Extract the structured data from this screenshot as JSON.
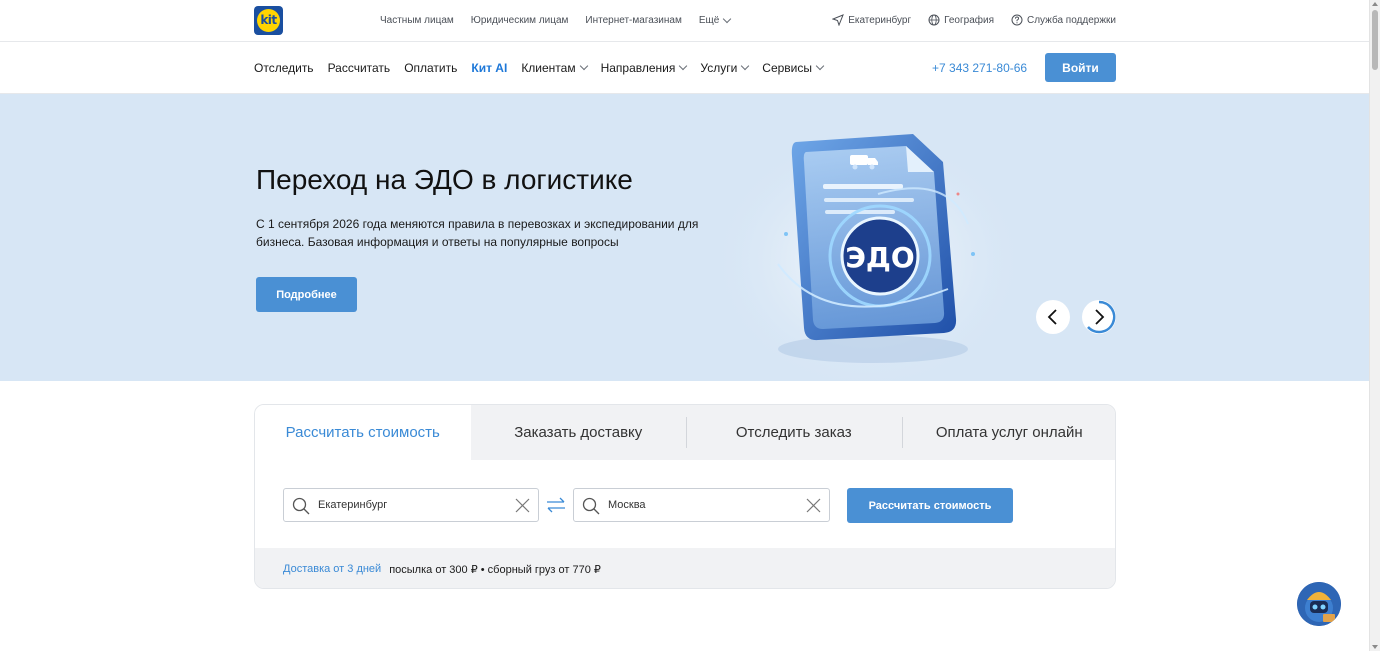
{
  "logo": {
    "text": "kit"
  },
  "topbar": {
    "links": [
      {
        "label": "Частным лицам"
      },
      {
        "label": "Юридическим лицам"
      },
      {
        "label": "Интернет-магазинам"
      },
      {
        "label": "Ещё"
      }
    ],
    "city": "Екатеринбург",
    "geography": "География",
    "support": "Служба поддержки"
  },
  "nav": {
    "items": [
      {
        "label": "Отследить"
      },
      {
        "label": "Рассчитать"
      },
      {
        "label": "Оплатить"
      },
      {
        "label": "Кит AI"
      },
      {
        "label": "Клиентам"
      },
      {
        "label": "Направления"
      },
      {
        "label": "Услуги"
      },
      {
        "label": "Сервисы"
      }
    ],
    "phone": "+7 343 271-80-66",
    "login": "Войти"
  },
  "hero": {
    "title": "Переход на ЭДО в логистике",
    "text": "С 1 сентября 2026 года меняются правила в перевозках и экспедировании для бизнеса. Базовая информация и ответы на популярные вопросы",
    "button": "Подробнее",
    "art_label": "ЭДО"
  },
  "widget": {
    "tabs": [
      {
        "label": "Рассчитать стоимость"
      },
      {
        "label": "Заказать доставку"
      },
      {
        "label": "Отследить заказ"
      },
      {
        "label": "Оплата услуг онлайн"
      }
    ],
    "from": "Екатеринбург",
    "to": "Москва",
    "calc_button": "Рассчитать стоимость",
    "delivery_link": "Доставка от 3 дней",
    "delivery_text": "посылка от 300 ₽ • сборный груз от 770 ₽"
  },
  "colors": {
    "accent": "#4a90d4",
    "link": "#3a8ad6",
    "hero_bg": "#d7e6f5",
    "logo_yellow": "#ffd400",
    "logo_blue": "#1a4fa0"
  }
}
